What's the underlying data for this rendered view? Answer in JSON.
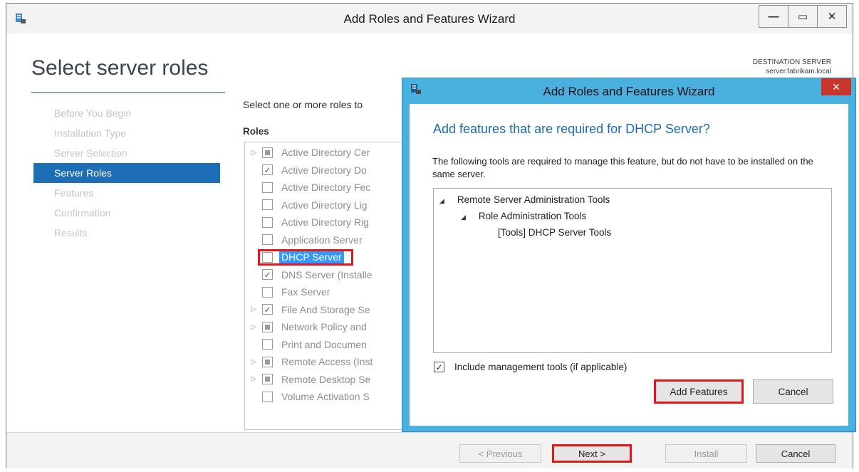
{
  "window": {
    "title": "Add Roles and Features Wizard",
    "minimize": "—",
    "maximize": "▭",
    "close": "✕"
  },
  "page": {
    "title": "Select server roles",
    "destination_label": "DESTINATION SERVER",
    "destination_value": "server.fabrikam.local"
  },
  "steps": [
    "Before You Begin",
    "Installation Type",
    "Server Selection",
    "Server Roles",
    "Features",
    "Confirmation",
    "Results"
  ],
  "main": {
    "instruction": "Select one or more roles to",
    "roles_header": "Roles"
  },
  "roles": [
    {
      "label": "Active Directory Cer",
      "expand": "▷",
      "check": ""
    },
    {
      "label": "Active Directory Do",
      "expand": "",
      "check": "✓"
    },
    {
      "label": "Active Directory Fec",
      "expand": "",
      "check": ""
    },
    {
      "label": "Active Directory Lig",
      "expand": "",
      "check": ""
    },
    {
      "label": "Active Directory Rig",
      "expand": "",
      "check": ""
    },
    {
      "label": "Application Server",
      "expand": "",
      "check": ""
    },
    {
      "label": "DHCP Server",
      "expand": "",
      "check": ""
    },
    {
      "label": "DNS Server (Installe",
      "expand": "",
      "check": "✓"
    },
    {
      "label": "Fax Server",
      "expand": "",
      "check": ""
    },
    {
      "label": "File And Storage Se",
      "expand": "▷",
      "check": "✓"
    },
    {
      "label": "Network Policy and",
      "expand": "▷",
      "check": ""
    },
    {
      "label": "Print and Documen",
      "expand": "",
      "check": ""
    },
    {
      "label": "Remote Access (Inst",
      "expand": "▷",
      "check": ""
    },
    {
      "label": "Remote Desktop Se",
      "expand": "▷",
      "check": ""
    },
    {
      "label": "Volume Activation S",
      "expand": "",
      "check": ""
    }
  ],
  "footer": {
    "previous": "< Previous",
    "next": "Next >",
    "install": "Install",
    "cancel": "Cancel"
  },
  "dialog": {
    "title": "Add Roles and Features Wizard",
    "close": "✕",
    "heading": "Add features that are required for DHCP Server?",
    "description": "The following tools are required to manage this feature, but do not have to be installed on the same server.",
    "tree": [
      {
        "label": "Remote Server Administration Tools",
        "tri": "◢"
      },
      {
        "label": "Role Administration Tools",
        "tri": "◢"
      },
      {
        "label": "[Tools] DHCP Server Tools",
        "tri": ""
      }
    ],
    "include_label": "Include management tools (if applicable)",
    "include_check": "✓",
    "add_features": "Add Features",
    "cancel": "Cancel"
  },
  "colors": {
    "accent": "#1e6eb6",
    "dialog_frame": "#4ab0e0",
    "highlight": "#e01818"
  }
}
